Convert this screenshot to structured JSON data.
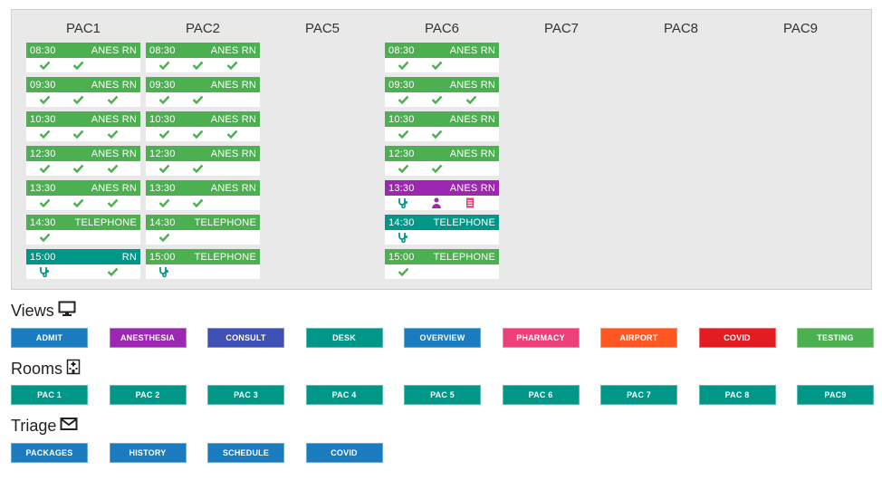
{
  "schedule": {
    "columns": [
      {
        "title": "PAC1",
        "slots": [
          {
            "time": "08:30",
            "label": "ANES RN",
            "color": "green",
            "marks": [
              "check",
              "check",
              ""
            ]
          },
          {
            "time": "09:30",
            "label": "ANES RN",
            "color": "green",
            "marks": [
              "check",
              "check",
              "check"
            ]
          },
          {
            "time": "10:30",
            "label": "ANES RN",
            "color": "green",
            "marks": [
              "check",
              "check",
              "check"
            ]
          },
          {
            "time": "12:30",
            "label": "ANES RN",
            "color": "green",
            "marks": [
              "check",
              "check",
              "check"
            ]
          },
          {
            "time": "13:30",
            "label": "ANES RN",
            "color": "green",
            "marks": [
              "check",
              "check",
              "check"
            ]
          },
          {
            "time": "14:30",
            "label": "TELEPHONE",
            "color": "green",
            "marks": [
              "check",
              "",
              ""
            ]
          },
          {
            "time": "15:00",
            "label": "RN",
            "color": "teal",
            "marks": [
              "stethoscope",
              "",
              "check"
            ]
          }
        ]
      },
      {
        "title": "PAC2",
        "slots": [
          {
            "time": "08:30",
            "label": "ANES RN",
            "color": "green",
            "marks": [
              "check",
              "check",
              "check"
            ]
          },
          {
            "time": "09:30",
            "label": "ANES RN",
            "color": "green",
            "marks": [
              "check",
              "check",
              ""
            ]
          },
          {
            "time": "10:30",
            "label": "ANES RN",
            "color": "green",
            "marks": [
              "check",
              "check",
              "check"
            ]
          },
          {
            "time": "12:30",
            "label": "ANES RN",
            "color": "green",
            "marks": [
              "check",
              "check",
              ""
            ]
          },
          {
            "time": "13:30",
            "label": "ANES RN",
            "color": "green",
            "marks": [
              "check",
              "check",
              ""
            ]
          },
          {
            "time": "14:30",
            "label": "TELEPHONE",
            "color": "green",
            "marks": [
              "check",
              "",
              ""
            ]
          },
          {
            "time": "15:00",
            "label": "TELEPHONE",
            "color": "green",
            "marks": [
              "stethoscope",
              "",
              ""
            ]
          }
        ]
      },
      {
        "title": "PAC5",
        "slots": []
      },
      {
        "title": "PAC6",
        "slots": [
          {
            "time": "08:30",
            "label": "ANES RN",
            "color": "green",
            "marks": [
              "check",
              "check",
              ""
            ]
          },
          {
            "time": "09:30",
            "label": "ANES RN",
            "color": "green",
            "marks": [
              "check",
              "check",
              "check"
            ]
          },
          {
            "time": "10:30",
            "label": "ANES RN",
            "color": "green",
            "marks": [
              "check",
              "check",
              ""
            ]
          },
          {
            "time": "12:30",
            "label": "ANES RN",
            "color": "green",
            "marks": [
              "check",
              "check",
              ""
            ]
          },
          {
            "time": "13:30",
            "label": "ANES RN",
            "color": "purple",
            "marks": [
              "stethoscope",
              "person",
              "document"
            ]
          },
          {
            "time": "14:30",
            "label": "TELEPHONE",
            "color": "teal",
            "marks": [
              "stethoscope",
              "",
              ""
            ]
          },
          {
            "time": "15:00",
            "label": "TELEPHONE",
            "color": "green",
            "marks": [
              "check",
              "",
              ""
            ]
          }
        ]
      },
      {
        "title": "PAC7",
        "slots": []
      },
      {
        "title": "PAC8",
        "slots": []
      },
      {
        "title": "PAC9",
        "slots": []
      }
    ]
  },
  "views": {
    "title": "Views",
    "icon": "monitor-icon",
    "buttons": [
      {
        "label": "ADMIT",
        "color": "#1a7bbf"
      },
      {
        "label": "ANESTHESIA",
        "color": "#9c27b0"
      },
      {
        "label": "CONSULT",
        "color": "#3f51b5"
      },
      {
        "label": "DESK",
        "color": "#009688"
      },
      {
        "label": "OVERVIEW",
        "color": "#1a7bbf"
      },
      {
        "label": "PHARMACY",
        "color": "#ec407a"
      },
      {
        "label": "AIRPORT",
        "color": "#ff5722"
      },
      {
        "label": "COVID",
        "color": "#e31b23"
      },
      {
        "label": "TESTING",
        "color": "#4caf50"
      }
    ]
  },
  "rooms": {
    "title": "Rooms",
    "icon": "hospital-icon",
    "buttons": [
      {
        "label": "PAC 1",
        "color": "#009688"
      },
      {
        "label": "PAC 2",
        "color": "#009688"
      },
      {
        "label": "PAC 3",
        "color": "#009688"
      },
      {
        "label": "PAC 4",
        "color": "#009688"
      },
      {
        "label": "PAC 5",
        "color": "#009688"
      },
      {
        "label": "PAC 6",
        "color": "#009688"
      },
      {
        "label": "PAC 7",
        "color": "#009688"
      },
      {
        "label": "PAC 8",
        "color": "#009688"
      },
      {
        "label": "PAC9",
        "color": "#009688"
      }
    ]
  },
  "triage": {
    "title": "Triage",
    "icon": "envelope-icon",
    "buttons": [
      {
        "label": "PACKAGES",
        "color": "#1a7bbf"
      },
      {
        "label": "HISTORY",
        "color": "#1a7bbf"
      },
      {
        "label": "SCHEDULE",
        "color": "#1a7bbf"
      },
      {
        "label": "COVID",
        "color": "#1a7bbf"
      }
    ]
  },
  "colors": {
    "green": "#4caf50",
    "teal": "#009688",
    "purple": "#9c27b0",
    "check": "#4caf50",
    "stethoscope": "#009688",
    "person": "#9c27b0",
    "document": "#ec407a"
  }
}
